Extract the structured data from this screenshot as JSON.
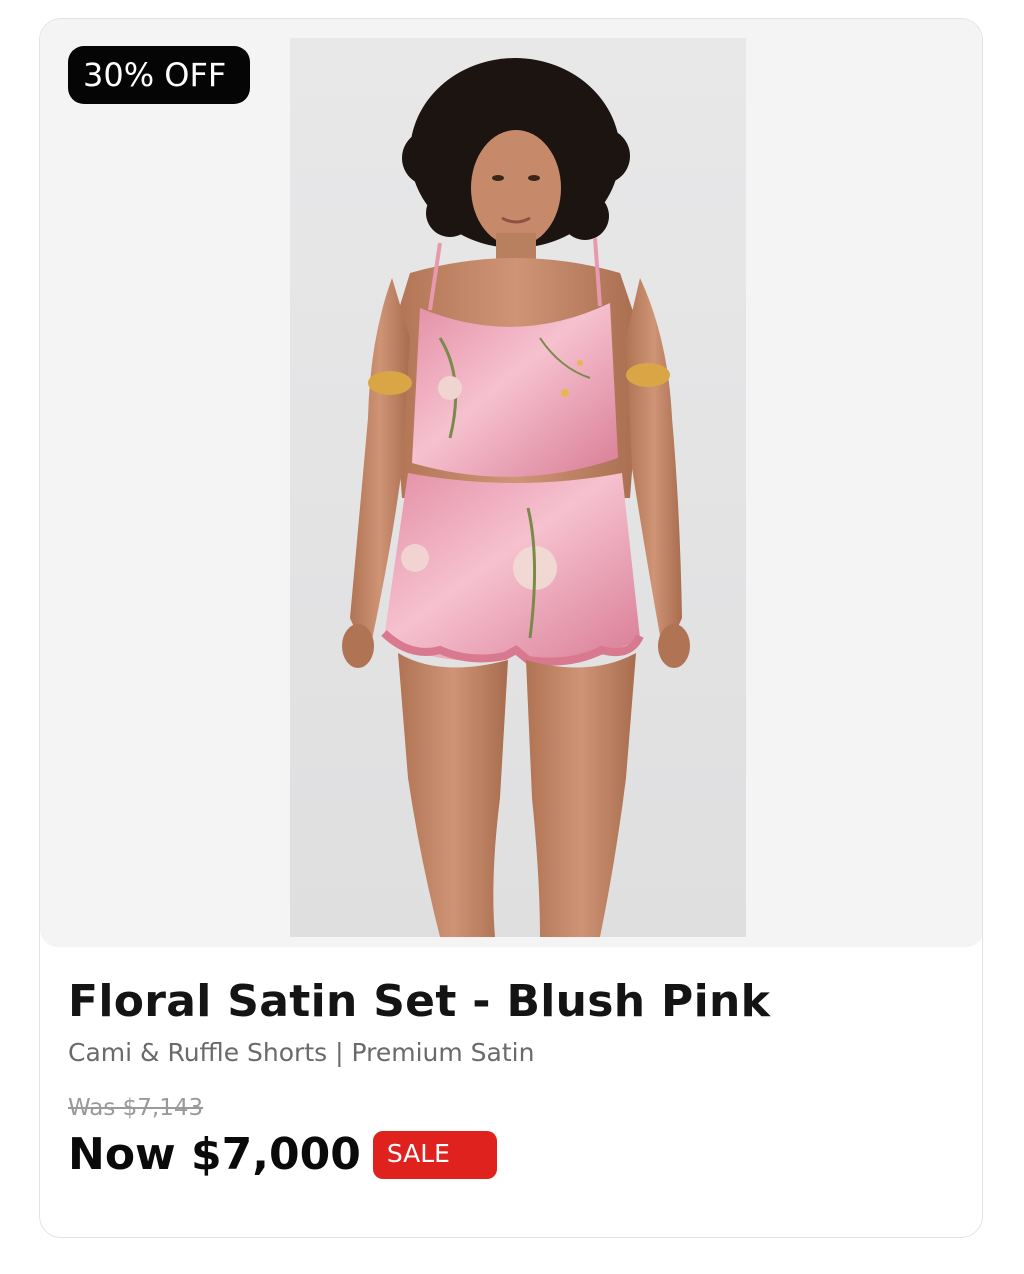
{
  "product": {
    "discount_badge": "30% OFF",
    "image_alt": "Model wearing floral satin cami and ruffle shorts set",
    "title": "Floral Satin Set - Blush Pink",
    "subtitle": "Cami & Ruffle Shorts | Premium Satin",
    "was_price": "Was $7,143",
    "now_price": "Now $7,000",
    "sale_badge": "SALE"
  },
  "colors": {
    "badge_bg": "#050505",
    "sale_bg": "#e0221f",
    "satin_pink": "#e59aae",
    "photo_bg": "#e5e5e6"
  }
}
